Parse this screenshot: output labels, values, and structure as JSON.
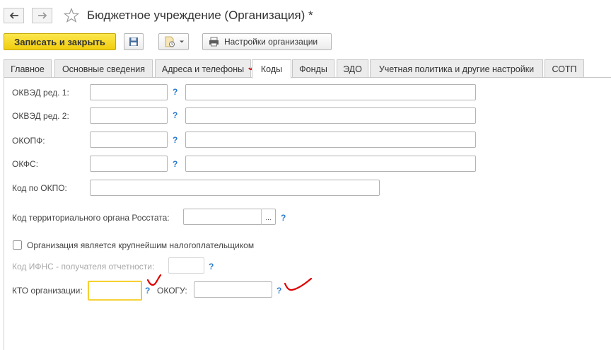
{
  "window": {
    "title": "Бюджетное учреждение (Организация) *",
    "icons": {
      "back": "arrow-left-icon",
      "forward": "arrow-right-icon",
      "favorite": "star-icon"
    }
  },
  "toolbar": {
    "save_close_label": "Записать и закрыть",
    "save_icon": "floppy-disk-icon",
    "history_icon": "document-history-icon",
    "settings_label": "Настройки организации",
    "settings_icon": "printer-icon"
  },
  "tabs": [
    {
      "label": "Главное",
      "active": false
    },
    {
      "label": "Основные сведения",
      "active": false
    },
    {
      "label": "Адреса и телефоны",
      "active": false
    },
    {
      "label": "Коды",
      "active": true
    },
    {
      "label": "Фонды",
      "active": false
    },
    {
      "label": "ЭДО",
      "active": false
    },
    {
      "label": "Учетная политика и другие настройки",
      "active": false
    },
    {
      "label": "СОТП",
      "active": false
    }
  ],
  "form": {
    "okved1": {
      "label": "ОКВЭД ред. 1:",
      "code": "",
      "description": "",
      "help": "?"
    },
    "okved2": {
      "label": "ОКВЭД ред. 2:",
      "code": "",
      "description": "",
      "help": "?"
    },
    "okopf": {
      "label": "ОКОПФ:",
      "code": "",
      "description": "",
      "help": "?"
    },
    "okfs": {
      "label": "ОКФС:",
      "code": "",
      "description": "",
      "help": "?"
    },
    "okpo": {
      "label": "Код по ОКПО:",
      "value": ""
    },
    "rosstat": {
      "label": "Код территориального органа Росстата:",
      "value": "",
      "select_button": "...",
      "help": "?"
    },
    "largest_taxpayer": {
      "label": "Организация является крупнейшим налогоплательщиком",
      "checked": false
    },
    "ifns": {
      "label": "Код ИФНС - получателя отчетности:",
      "value": "",
      "help": "?"
    },
    "kto": {
      "label": "КТО организации:",
      "value": "",
      "help": "?"
    },
    "okogu": {
      "label": "ОКОГУ:",
      "value": "",
      "help": "?"
    }
  },
  "annotation_color": "#e00000",
  "accent_color": "#f1cd0e"
}
